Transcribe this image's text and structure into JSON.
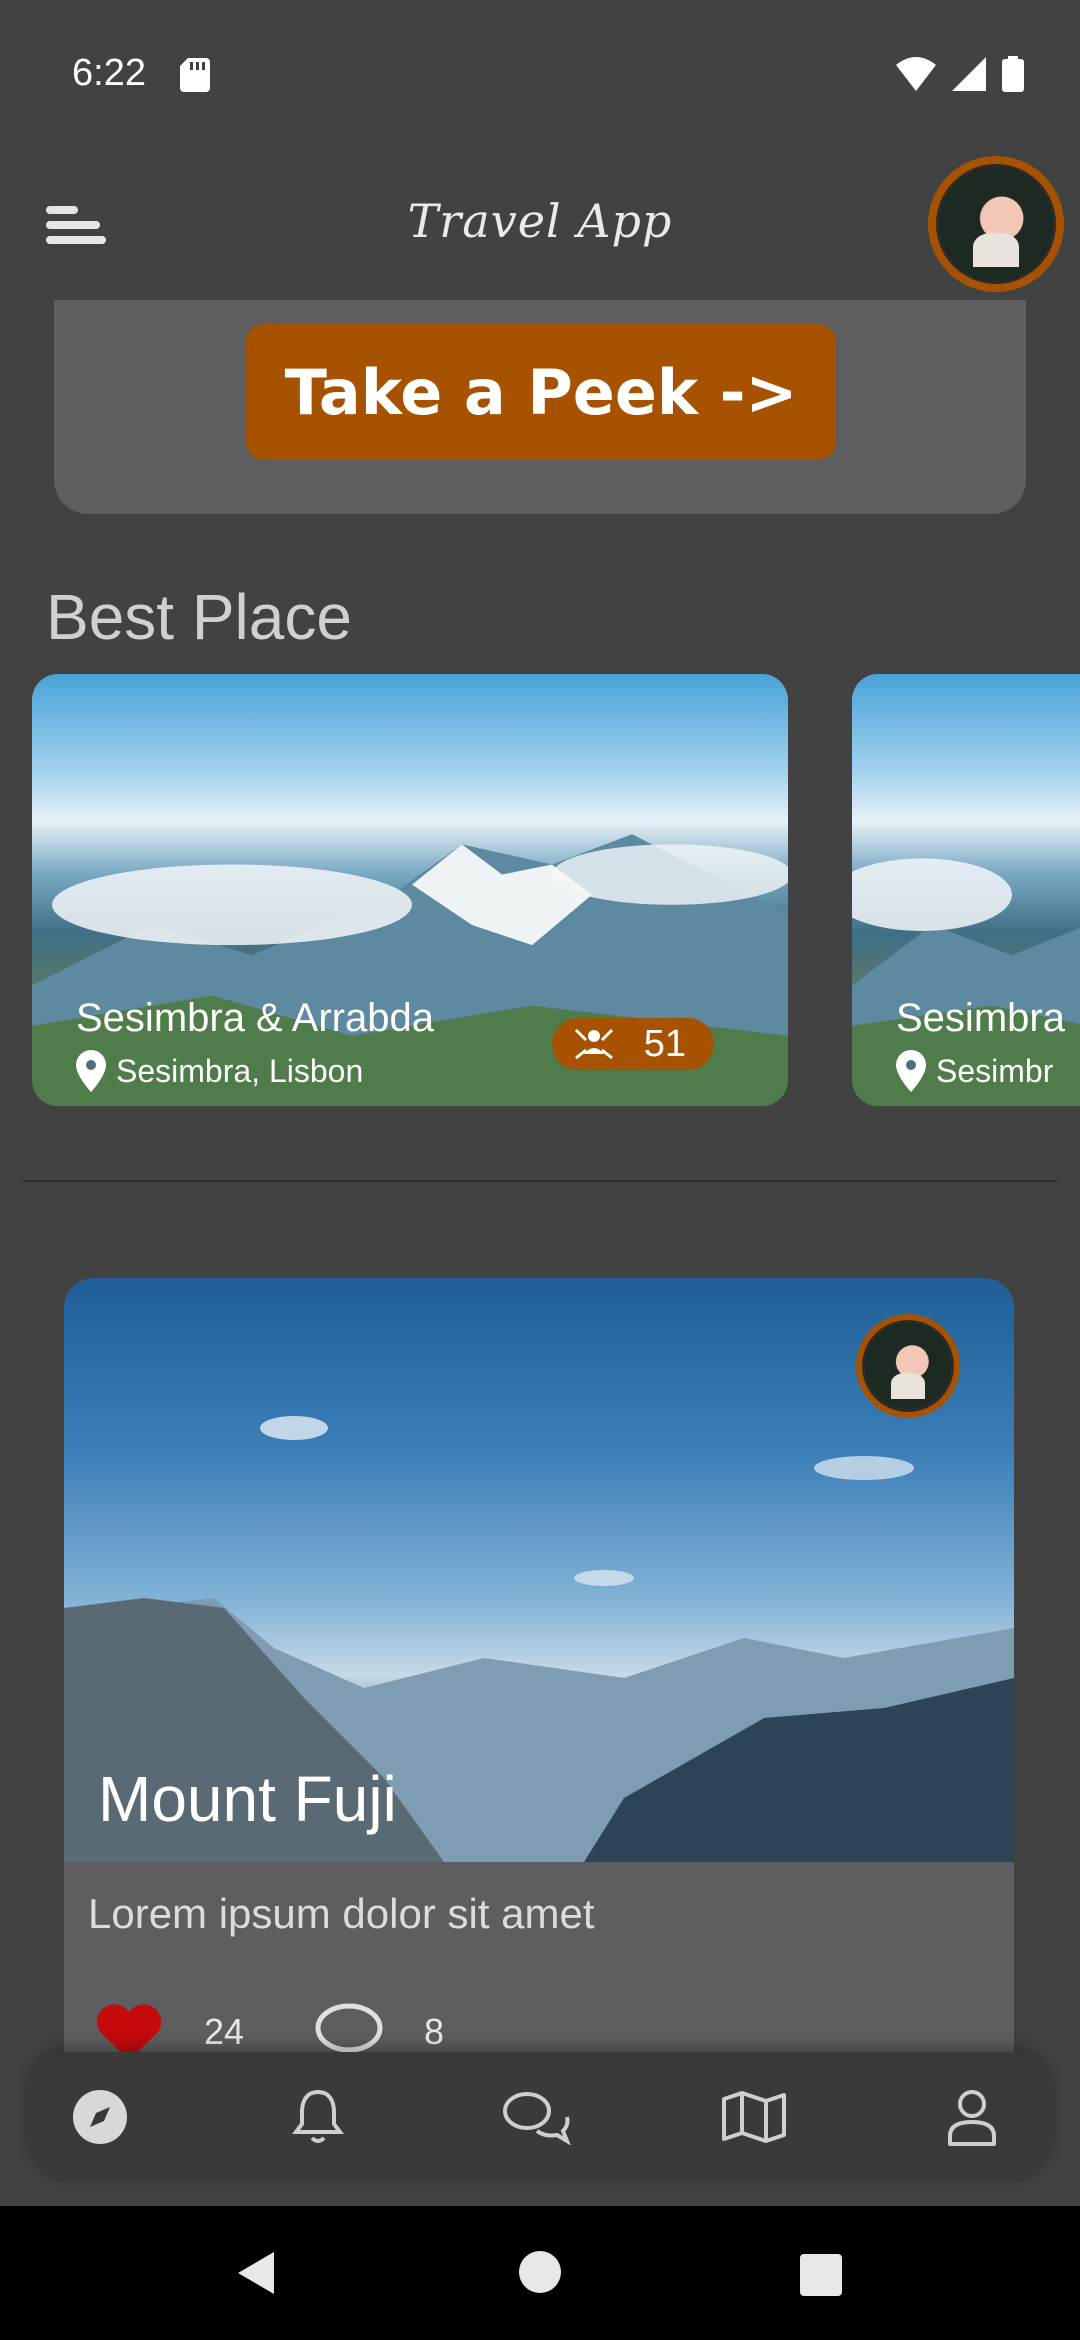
{
  "status_bar": {
    "time": "6:22"
  },
  "app_bar": {
    "title": "Travel App"
  },
  "promo": {
    "button_label": "Take a Peek ->"
  },
  "best_place": {
    "title": "Best Place",
    "cards": [
      {
        "name": "Sesimbra & Arrabda",
        "location": "Sesimbra, Lisbon",
        "visitors": "51"
      },
      {
        "name": "Sesimbra",
        "location": "Sesimbr"
      }
    ]
  },
  "feature": {
    "title": "Mount Fuji",
    "description": "Lorem ipsum dolor sit amet",
    "likes": "24",
    "comments": "8"
  },
  "colors": {
    "accent": "#a65200",
    "background": "#424242",
    "card": "#5e5d5f"
  },
  "bottom_nav": [
    "explore-icon",
    "bell-icon",
    "chat-icon",
    "map-icon",
    "profile-icon"
  ]
}
